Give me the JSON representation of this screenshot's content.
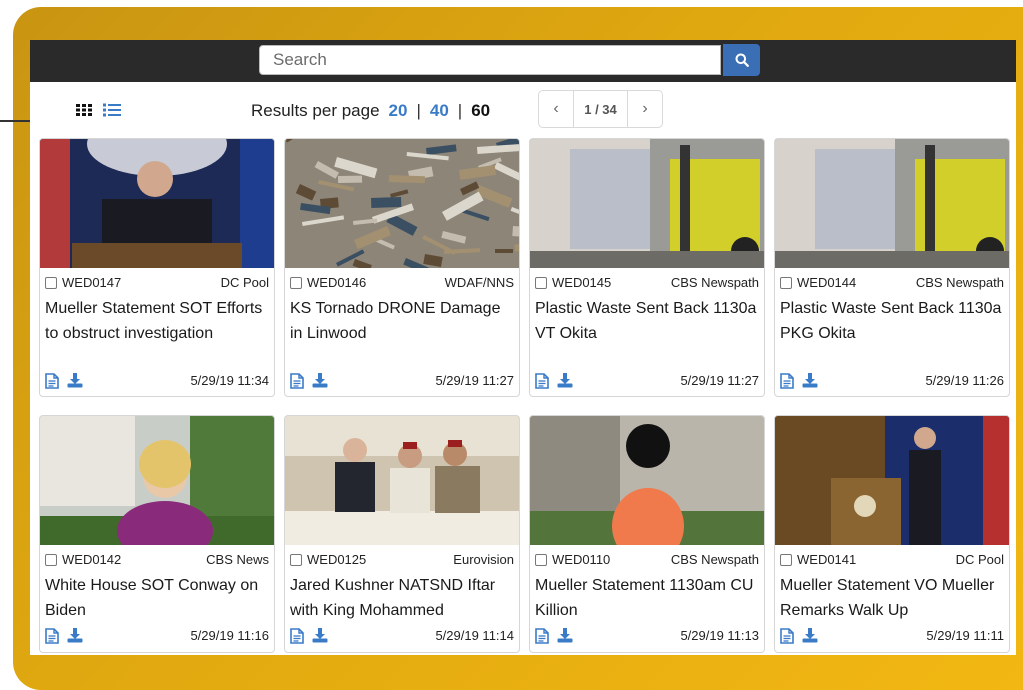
{
  "search": {
    "placeholder": "Search"
  },
  "toolbar": {
    "results_per_page_label": "Results per page",
    "page_sizes": [
      "20",
      "40",
      "60"
    ],
    "separator": "|",
    "current_page_size": "60",
    "page_info": "1 / 34",
    "prev_glyph": "‹",
    "next_glyph": "›"
  },
  "colors": {
    "accent": "#3a7bc8",
    "frame": "#e1a910",
    "topbar": "#2a2a2a"
  },
  "icons": {
    "search": "search-icon",
    "grid": "grid-view-icon",
    "list": "list-view-icon",
    "doc": "document-icon",
    "download": "download-icon"
  },
  "results": [
    {
      "slug": "WED0147",
      "source": "DC Pool",
      "title": "Mueller Statement SOT Efforts to obstruct investigation",
      "date": "5/29/19 11:34"
    },
    {
      "slug": "WED0146",
      "source": "WDAF/NNS",
      "title": "KS Tornado DRONE Damage in Linwood",
      "date": "5/29/19 11:27"
    },
    {
      "slug": "WED0145",
      "source": "CBS Newspath",
      "title": "Plastic Waste Sent Back 1130a VT Okita",
      "date": "5/29/19 11:27"
    },
    {
      "slug": "WED0144",
      "source": "CBS Newspath",
      "title": "Plastic Waste Sent Back 1130a PKG Okita",
      "date": "5/29/19 11:26"
    },
    {
      "slug": "WED0142",
      "source": "CBS News",
      "title": "White House SOT Conway on Biden",
      "date": "5/29/19 11:16"
    },
    {
      "slug": "WED0125",
      "source": "Eurovision",
      "title": "Jared Kushner NATSND Iftar with King Mohammed",
      "date": "5/29/19 11:14"
    },
    {
      "slug": "WED0110",
      "source": "CBS Newspath",
      "title": "Mueller Statement 1130am CU Killion",
      "date": "5/29/19 11:13"
    },
    {
      "slug": "WED0141",
      "source": "DC Pool",
      "title": "Mueller Statement VO Mueller Remarks Walk Up",
      "date": "5/29/19 11:11"
    }
  ]
}
